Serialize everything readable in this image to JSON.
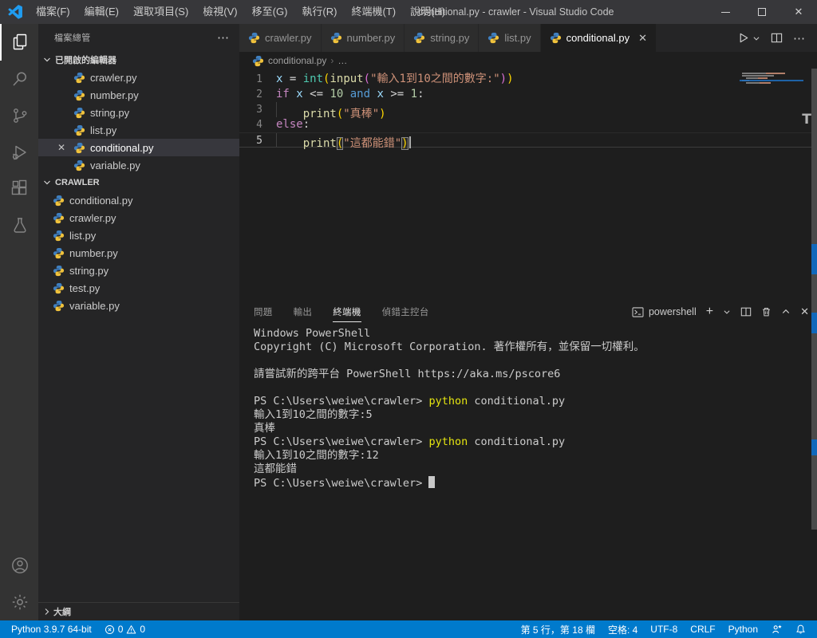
{
  "window": {
    "title": "conditional.py - crawler - Visual Studio Code"
  },
  "menu_bar": [
    "檔案(F)",
    "編輯(E)",
    "選取項目(S)",
    "檢視(V)",
    "移至(G)",
    "執行(R)",
    "終端機(T)",
    "說明(H)"
  ],
  "activity_bar": {
    "top": [
      {
        "id": "explorer",
        "active": true
      },
      {
        "id": "search"
      },
      {
        "id": "source-control"
      },
      {
        "id": "run-debug"
      },
      {
        "id": "extensions"
      },
      {
        "id": "testing"
      }
    ],
    "bottom": [
      {
        "id": "account"
      },
      {
        "id": "settings"
      }
    ]
  },
  "sidebar": {
    "title": "檔案總管",
    "more_actions": "⋯",
    "open_editors": {
      "label": "已開啟的編輯器",
      "items": [
        {
          "name": "crawler.py"
        },
        {
          "name": "number.py"
        },
        {
          "name": "string.py"
        },
        {
          "name": "list.py"
        },
        {
          "name": "conditional.py",
          "selected": true,
          "close": true
        },
        {
          "name": "variable.py"
        }
      ]
    },
    "folder": {
      "name": "CRAWLER",
      "items": [
        "conditional.py",
        "crawler.py",
        "list.py",
        "number.py",
        "string.py",
        "test.py",
        "variable.py"
      ]
    },
    "outline_label": "大綱"
  },
  "editor": {
    "tabs": [
      {
        "label": "crawler.py"
      },
      {
        "label": "number.py"
      },
      {
        "label": "string.py"
      },
      {
        "label": "list.py"
      },
      {
        "label": "conditional.py",
        "active": true,
        "close": "✕"
      }
    ],
    "breadcrumb": {
      "file": "conditional.py",
      "more": "…"
    },
    "code": {
      "lines": [
        {
          "num": 1,
          "indent": 0,
          "tokens": [
            {
              "t": "x",
              "c": "var"
            },
            {
              "t": " = ",
              "c": "op"
            },
            {
              "t": "int",
              "c": "builtin"
            },
            {
              "t": "(",
              "c": "b1"
            },
            {
              "t": "input",
              "c": "fn"
            },
            {
              "t": "(",
              "c": "b2"
            },
            {
              "t": "\"輸入1到10之間的數字:\"",
              "c": "str"
            },
            {
              "t": ")",
              "c": "b2"
            },
            {
              "t": ")",
              "c": "b1"
            }
          ]
        },
        {
          "num": 2,
          "indent": 0,
          "tokens": [
            {
              "t": "if ",
              "c": "kw"
            },
            {
              "t": "x",
              "c": "var"
            },
            {
              "t": " <= ",
              "c": "op"
            },
            {
              "t": "10",
              "c": "num"
            },
            {
              "t": " ",
              "c": "op"
            },
            {
              "t": "and",
              "c": "kwb"
            },
            {
              "t": " ",
              "c": "op"
            },
            {
              "t": "x",
              "c": "var"
            },
            {
              "t": " >= ",
              "c": "op"
            },
            {
              "t": "1",
              "c": "num"
            },
            {
              "t": ":",
              "c": "op"
            }
          ]
        },
        {
          "num": 3,
          "indent": 1,
          "tokens": [
            {
              "t": "print",
              "c": "fn"
            },
            {
              "t": "(",
              "c": "b1"
            },
            {
              "t": "\"真棒\"",
              "c": "str"
            },
            {
              "t": ")",
              "c": "b1"
            }
          ]
        },
        {
          "num": 4,
          "indent": 0,
          "tokens": [
            {
              "t": "else",
              "c": "kw"
            },
            {
              "t": ":",
              "c": "op"
            }
          ]
        },
        {
          "num": 5,
          "indent": 1,
          "active": true,
          "cursor": true,
          "tokens": [
            {
              "t": "print",
              "c": "fn"
            },
            {
              "t": "(",
              "c": "b1",
              "box": true
            },
            {
              "t": "\"這都能錯\"",
              "c": "str"
            },
            {
              "t": ")",
              "c": "b1",
              "box": true
            }
          ]
        }
      ]
    }
  },
  "panel": {
    "tabs": [
      {
        "label": "問題"
      },
      {
        "label": "輸出"
      },
      {
        "label": "終端機",
        "active": true
      },
      {
        "label": "偵錯主控台"
      }
    ],
    "shell_label": "powershell",
    "terminal_lines": [
      {
        "tokens": [
          {
            "t": "Windows PowerShell"
          }
        ]
      },
      {
        "tokens": [
          {
            "t": "Copyright (C) Microsoft Corporation. 著作權所有，並保留一切權利。"
          }
        ]
      },
      {
        "tokens": []
      },
      {
        "tokens": [
          {
            "t": "請嘗試新的跨平台 PowerShell https://aka.ms/pscore6"
          }
        ]
      },
      {
        "tokens": []
      },
      {
        "tokens": [
          {
            "t": "PS C:\\Users\\weiwe\\crawler> "
          },
          {
            "t": "python",
            "c": "cmd"
          },
          {
            "t": " conditional.py"
          }
        ]
      },
      {
        "tokens": [
          {
            "t": "輸入1到10之間的數字:5"
          }
        ]
      },
      {
        "tokens": [
          {
            "t": "真棒"
          }
        ]
      },
      {
        "tokens": [
          {
            "t": "PS C:\\Users\\weiwe\\crawler> "
          },
          {
            "t": "python",
            "c": "cmd"
          },
          {
            "t": " conditional.py"
          }
        ]
      },
      {
        "tokens": [
          {
            "t": "輸入1到10之間的數字:12"
          }
        ]
      },
      {
        "tokens": [
          {
            "t": "這都能錯"
          }
        ]
      },
      {
        "tokens": [
          {
            "t": "PS C:\\Users\\weiwe\\crawler> "
          }
        ],
        "cursor": true
      }
    ]
  },
  "status_bar": {
    "python_version": "Python 3.9.7 64-bit",
    "errors": "0",
    "warnings": "0",
    "right_items": [
      "第 5 行，第 18 欄",
      "空格: 4",
      "UTF-8",
      "CRLF",
      "Python"
    ]
  },
  "colors": {
    "accent": "#007ACC",
    "title_bar": "#37373a",
    "activity_bar": "#333333",
    "sidebar": "#252526",
    "editor_bg": "#1e1e1e",
    "token": {
      "keyword": "#C586C0",
      "keyword_operator": "#569CD6",
      "variable": "#9CDCFE",
      "function": "#DCDCAA",
      "builtin": "#4EC9B0",
      "string": "#CE9178",
      "number": "#B5CEA8",
      "operator": "#D4D4D4",
      "bracket1": "#FFD700",
      "bracket2": "#DA70D6",
      "terminal_command": "#E5E510"
    }
  }
}
